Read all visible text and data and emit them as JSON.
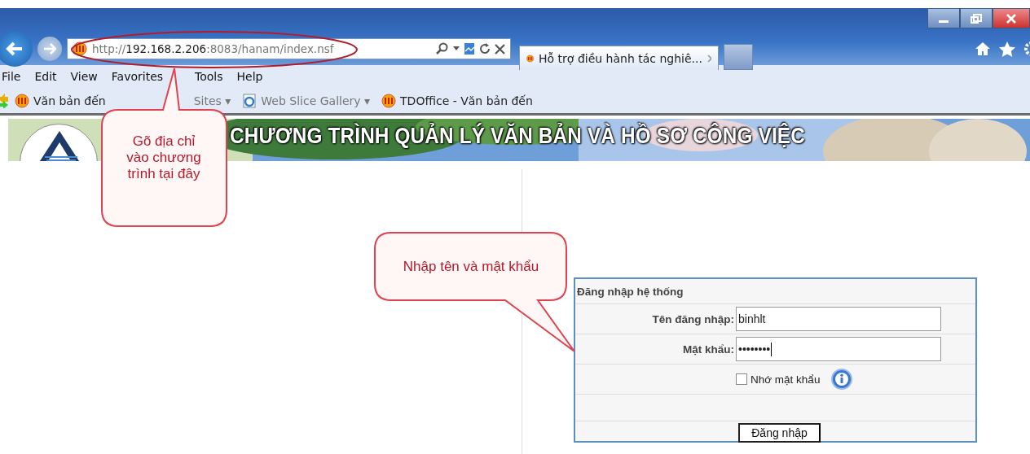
{
  "browser": {
    "address": "http://**192.168.2.206**:8083/hanam/index.nsf",
    "tab": {
      "title": "Hỗ trợ điều hành tác nghiê...",
      "selected": true
    },
    "menu": [
      "File",
      "Edit",
      "View",
      "Favorites",
      "Tools",
      "Help"
    ],
    "favorites": [
      {
        "label": "Văn bản đến",
        "kind": "site"
      },
      {
        "label": "Sites ▾",
        "kind": "suggested"
      },
      {
        "label": "Web Slice Gallery ▾",
        "kind": "slice"
      },
      {
        "label": "TDOffice - Văn bản đến",
        "kind": "site"
      }
    ]
  },
  "banner": {
    "title": "CHƯƠNG TRÌNH QUẢN LÝ VĂN BẢN VÀ HỒ SƠ CÔNG VIỆC"
  },
  "login": {
    "heading": "Đăng nhập hệ thống",
    "username_label": "Tên đăng nhập:",
    "username": "binhlt",
    "password_label": "Mật khẩu:",
    "password": "••••••••",
    "remember": {
      "label": "Nhớ mật khẩu",
      "checked": false
    },
    "submit": "Đăng nhập"
  },
  "callouts": [
    {
      "text": "Gõ địa chỉ vào chương trình tại đây"
    },
    {
      "text": "Nhập tên và mật khẩu"
    }
  ]
}
